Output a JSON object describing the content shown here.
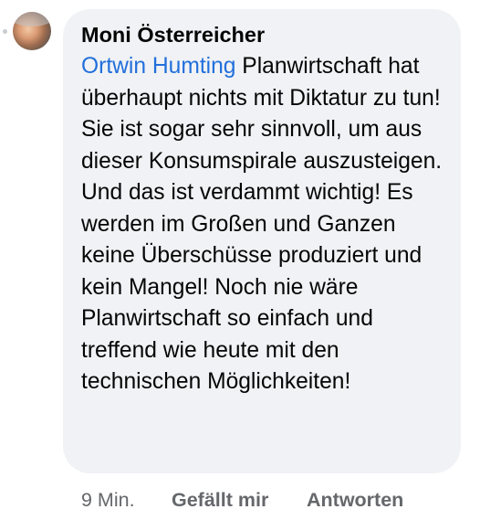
{
  "comment": {
    "author": "Moni Österreicher",
    "mention": "Ortwin Humting",
    "text": " Planwirtschaft hat überhaupt nichts mit Diktatur zu tun! Sie ist sogar sehr sinnvoll, um aus dieser Konsumspirale auszusteigen. Und das ist verdammt wichtig! Es werden im Großen und Ganzen keine Überschüsse produziert und kein Mangel! Noch nie wäre Planwirtschaft so einfach und treffend wie heute mit den technischen Möglichkeiten!"
  },
  "actions": {
    "timestamp": "9 Min.",
    "like_label": "Gefällt mir",
    "reply_label": "Antworten"
  },
  "colors": {
    "bubble_background": "#f0f2f5",
    "mention_link": "#216fdb",
    "secondary_text": "#65676b"
  }
}
